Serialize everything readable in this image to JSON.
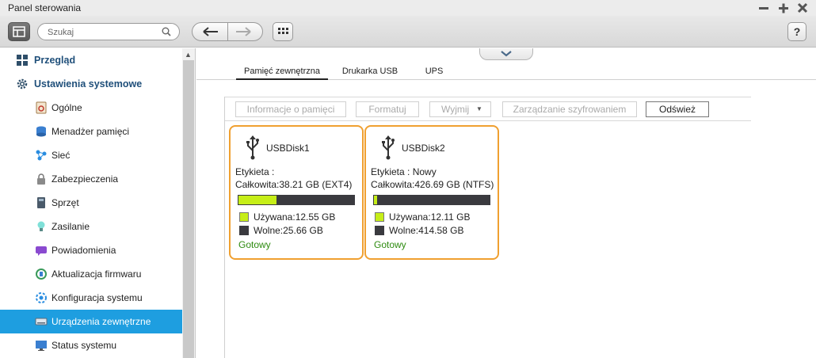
{
  "window": {
    "title": "Panel sterowania"
  },
  "toolbar": {
    "search_placeholder": "Szukaj",
    "help_label": "?"
  },
  "sidebar": {
    "items": [
      {
        "label": "Przegląd",
        "icon": "overview-icon",
        "level": "top"
      },
      {
        "label": "Ustawienia systemowe",
        "icon": "gear-icon",
        "level": "top"
      },
      {
        "label": "Ogólne",
        "icon": "general-settings-icon",
        "level": "sub"
      },
      {
        "label": "Menadżer pamięci",
        "icon": "storage-icon",
        "level": "sub"
      },
      {
        "label": "Sieć",
        "icon": "network-icon",
        "level": "sub"
      },
      {
        "label": "Zabezpieczenia",
        "icon": "lock-icon",
        "level": "sub"
      },
      {
        "label": "Sprzęt",
        "icon": "hardware-icon",
        "level": "sub"
      },
      {
        "label": "Zasilanie",
        "icon": "power-bulb-icon",
        "level": "sub"
      },
      {
        "label": "Powiadomienia",
        "icon": "notification-icon",
        "level": "sub"
      },
      {
        "label": "Aktualizacja firmwaru",
        "icon": "firmware-update-icon",
        "level": "sub"
      },
      {
        "label": "Konfiguracja systemu",
        "icon": "system-config-icon",
        "level": "sub"
      },
      {
        "label": "Urządzenia zewnętrzne",
        "icon": "external-device-icon",
        "level": "sub",
        "active": true
      },
      {
        "label": "Status systemu",
        "icon": "monitor-icon",
        "level": "sub"
      }
    ]
  },
  "tabs": [
    {
      "label": "Pamięć zewnętrzna",
      "active": true
    },
    {
      "label": "Drukarka USB"
    },
    {
      "label": "UPS"
    }
  ],
  "actions": {
    "memory_info": "Informacje o pamięci",
    "format": "Formatuj",
    "eject": "Wyjmij",
    "encryption": "Zarządzanie szyfrowaniem",
    "refresh": "Odśwież"
  },
  "disks": [
    {
      "name": "USBDisk1",
      "label_line": "Etykieta :",
      "total_line": "Całkowita:38.21 GB (EXT4)",
      "used_fraction": 0.33,
      "used": "Używana:12.55 GB",
      "free": "Wolne:25.66 GB",
      "status": "Gotowy"
    },
    {
      "name": "USBDisk2",
      "label_line": "Etykieta : Nowy",
      "total_line": "Całkowita:426.69 GB (NTFS)",
      "used_fraction": 0.03,
      "used": "Używana:12.11 GB",
      "free": "Wolne:414.58 GB",
      "status": "Gotowy"
    }
  ],
  "colors": {
    "accent": "#1e9ee0",
    "card_border": "#f0a030",
    "used_color": "#c6ee18",
    "free_color": "#3a3a3f",
    "status_ok": "#2e8b10"
  }
}
